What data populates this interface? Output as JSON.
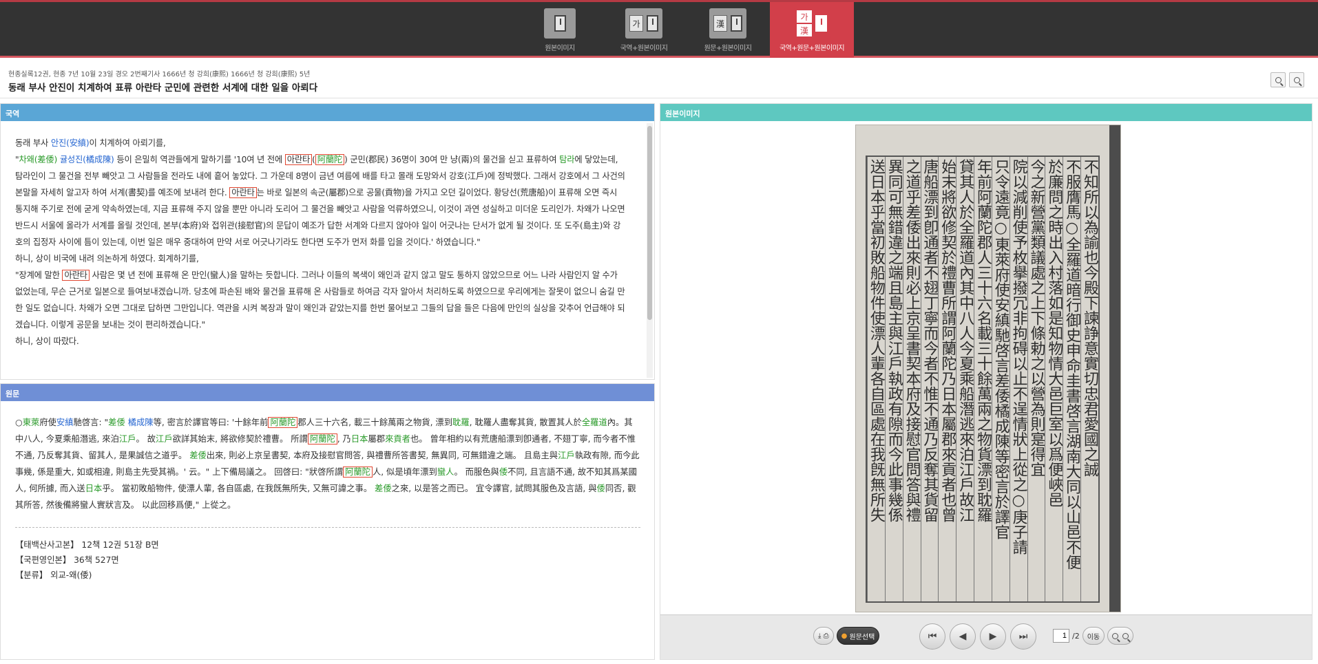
{
  "modes": [
    {
      "label": "원본이미지",
      "active": false
    },
    {
      "label": "국역+원본이미지",
      "active": false
    },
    {
      "label": "원문+원본이미지",
      "active": false
    },
    {
      "label": "국역+원문+원본이미지",
      "active": true
    }
  ],
  "glyphs": {
    "ga": "가",
    "han": "漢"
  },
  "breadcrumb": "현종실록12권, 현종 7년 10월 23일 경오 2번째기사 1666년 청 강희(康熙) 1666년 청 강희(康熙) 5년",
  "title": "동래 부사 안진이 치계하여 표류 아란타 군민에 관련한 서계에 대한 일을 아뢰다",
  "panels": {
    "translation": "국역",
    "original": "원문",
    "image": "원본이미지"
  },
  "translation": {
    "p1a": "동래 부사 ",
    "p1b": "안진(安縝)",
    "p1c": "이 치계하여 아뢰기를,",
    "p2a": "\"",
    "p2b": "차왜(差倭)",
    "p2c": " ",
    "p2d": "귤성진(橘成陳)",
    "p2e": " 등이 은밀히 역관들에게 말하기를 '10여 년 전에 ",
    "p2f": "아란타",
    "p2g": "(",
    "p2h": "阿蘭陀",
    "p2i": ") 군민(郡民) 36명이 30여 만 냥(兩)의 물건을 싣고 표류하여 ",
    "p2j": "탐라",
    "p2k": "에 닿았는데, 탐라인이 그 물건을 전부 빼앗고 그 사람들을 전라도 내에 흩어 놓았다. 그 가운데 8명이 금년 여름에 배를 타고 몰래 도망와서 강호(江戶)에 정박했다. 그래서 강호에서 그 사건의 본말을 자세히 알고자 하여 서계(書契)를 예조에 보내려 한다. ",
    "p2l": "아란타",
    "p2m": "는 바로 일본의 속군(屬郡)으로 공물(貢物)을 가지고 오던 길이었다. 황당선(荒唐船)이 표류해 오면 즉시 통지해 주기로 전에 굳게 약속하였는데, 지금 표류해 주지 않을 뿐만 아니라 도리어 그 물건을 빼앗고 사람을 억류하였으니, 이것이 과연 성실하고 미더운 도리인가. 차왜가 나오면 반드시 서울에 올라가 서계를 올릴 것인데, 본부(本府)와 접위관(接慰官)의 문답이 예조가 답한 서계와 다르지 않아야 일이 어긋나는 단서가 없게 될 것이다. 또 도주(島主)와 강호의 집정자 사이에 틈이 있는데, 이번 일은 매우 중대하여 만약 서로 어긋나기라도 한다면 도주가 먼저 화를 입을 것이다.' 하였습니다.\"",
    "p3": "하니, 상이 비국에 내려 의논하게 하였다. 회계하기를,",
    "p4a": "\"장계에 말한 ",
    "p4b": "아란타",
    "p4c": " 사람은 몇 년 전에 표류해 온 만인(蠻人)을 말하는 듯합니다. 그러나 이들의 복색이 왜인과 같지 않고 말도 통하지 않았으므로 어느 나라 사람인지 알 수가 없었는데, 무슨 근거로 일본으로 들여보내겠습니까. 당초에 파손된 배와 물건을 표류해 온 사람들로 하여금 각자 알아서 처리하도록 하였으므로 우리에게는 잘못이 없으니 숨길 만한 일도 없습니다. 차왜가 오면 그대로 답하면 그만입니다. 역관을 시켜 복장과 말이 왜인과 같았는지를 한번 물어보고 그들의 답을 들은 다음에 만인의 실상을 갖추어 언급해야 되겠습니다. 이렇게 공문을 보내는 것이 편리하겠습니다.\"",
    "p5": "하니, 상이 따랐다."
  },
  "original": {
    "o1": "○",
    "o2": "東萊",
    "o3": "府使",
    "o4": "安縝",
    "o5": "馳啓言: \"",
    "o6": "差倭",
    "o7": " ",
    "o8": "橘成陳",
    "o9": "等, 密言於譯官等曰: '十餘年前",
    "o10": "阿蘭陀",
    "o11": "郡人三十六名, 載三十餘萬兩之物貨, 漂到",
    "o12": "耽羅",
    "o13": ", 耽羅人盡奪其貨, 散置其人於",
    "o14": "全羅道",
    "o15": "內。其中八人, 今夏乘船潛逃, 來泊",
    "o16": "江戶",
    "o17": "。 故",
    "o18": "江戶",
    "o19": "欲詳其始末, 將欲修契於禮曹。 所謂",
    "o20": "阿蘭陀",
    "o21": ", 乃",
    "o22": "日本",
    "o23": "屬郡",
    "o24": "來貢者",
    "o25": "也。 曾年相約以有荒唐船漂到卽通者, 不翅丁寧, 而今者不惟不通, 乃反奪其貨、留其人, 是果誠信之道乎。 ",
    "o26": "差倭",
    "o27": "出來, 則必上京呈書契, 本府及接慰官問答, 與禮曹所答書契, 無異同, 可無錯違之端。 且島主與",
    "o28": "江戶",
    "o29": "執政有隙, 而今此事幾, 係是重大, 如或相違, 則島主先受其禍。' 云。\" 上下備局議之。 回啓曰: \"狀啓所謂",
    "o30": "阿蘭陀",
    "o31": "人, 似是頃年漂到",
    "o32": "蠻人",
    "o33": "。 而服色與",
    "o34": "倭",
    "o35": "不同, 且言語不通, 故不知其爲某國人, 何所據, 而入送",
    "o36": "日本",
    "o37": "乎。 當初敗船物件, 使漂人輩, 各自區處, 在我旣無所失, 又無可諱之事。 ",
    "o38": "差倭",
    "o39": "之來, 以是答之而已。 宜令譯官, 試問其服色及言語, 與",
    "o40": "倭",
    "o41": "同否, 觀其所答, 然後備將蠻人實狀言及。 以此回移爲便,\" 上從之。",
    "meta1": "【태백산사고본】 12책 12권 51장 B면",
    "meta2": "【국편영인본】 36책 527면",
    "meta3": "【분류】 외교-왜(倭)"
  },
  "scan_columns": [
    "不知所以為諭也今殿下諫諍意實切忠君愛國之誠",
    "不服膺馬○全羅道暗行御史申命圭書啓言湖南大同以山邑不便",
    "於廉問之時出入村落如是知物情大邑巨室以爲便峽邑",
    "今之新營黨類議處之上下條勅之以營為則寔得宜",
    "院以減削使予枚擧撥冗非拘碍以止不逞情狀上從之○庚子請",
    "只令遠竟○東萊府使安縝馳啓言差倭橘成陳等密言於譯官",
    "年前阿蘭陀郡人三十六名載三十餘萬兩之物貨漂到耽羅",
    "貸其人於全羅道內其中八人今夏乘船潛逃來泊江戶故江",
    "始末將欲修契於禮曹所謂阿蘭陀乃日本屬郡來貢者也曾",
    "唐船漂到卽通者不翅丁寧而今者不惟不通乃反奪其貨留",
    "之道乎差倭出來則必上京呈書契本府及接慰官問答與禮",
    "異同可無錯違之端且島主與江戶執政有隙而今此事幾係",
    "送日本乎當初敗船物件使漂人輩各自區處在我旣無所失"
  ],
  "viewer": {
    "download_label": "⤓",
    "print_label": "⎙",
    "select_label": "원문선택",
    "first": "⏮",
    "prev": "◀",
    "next": "▶",
    "last": "⏭",
    "page_current": "1",
    "page_total": "/2",
    "go_label": "이동"
  }
}
